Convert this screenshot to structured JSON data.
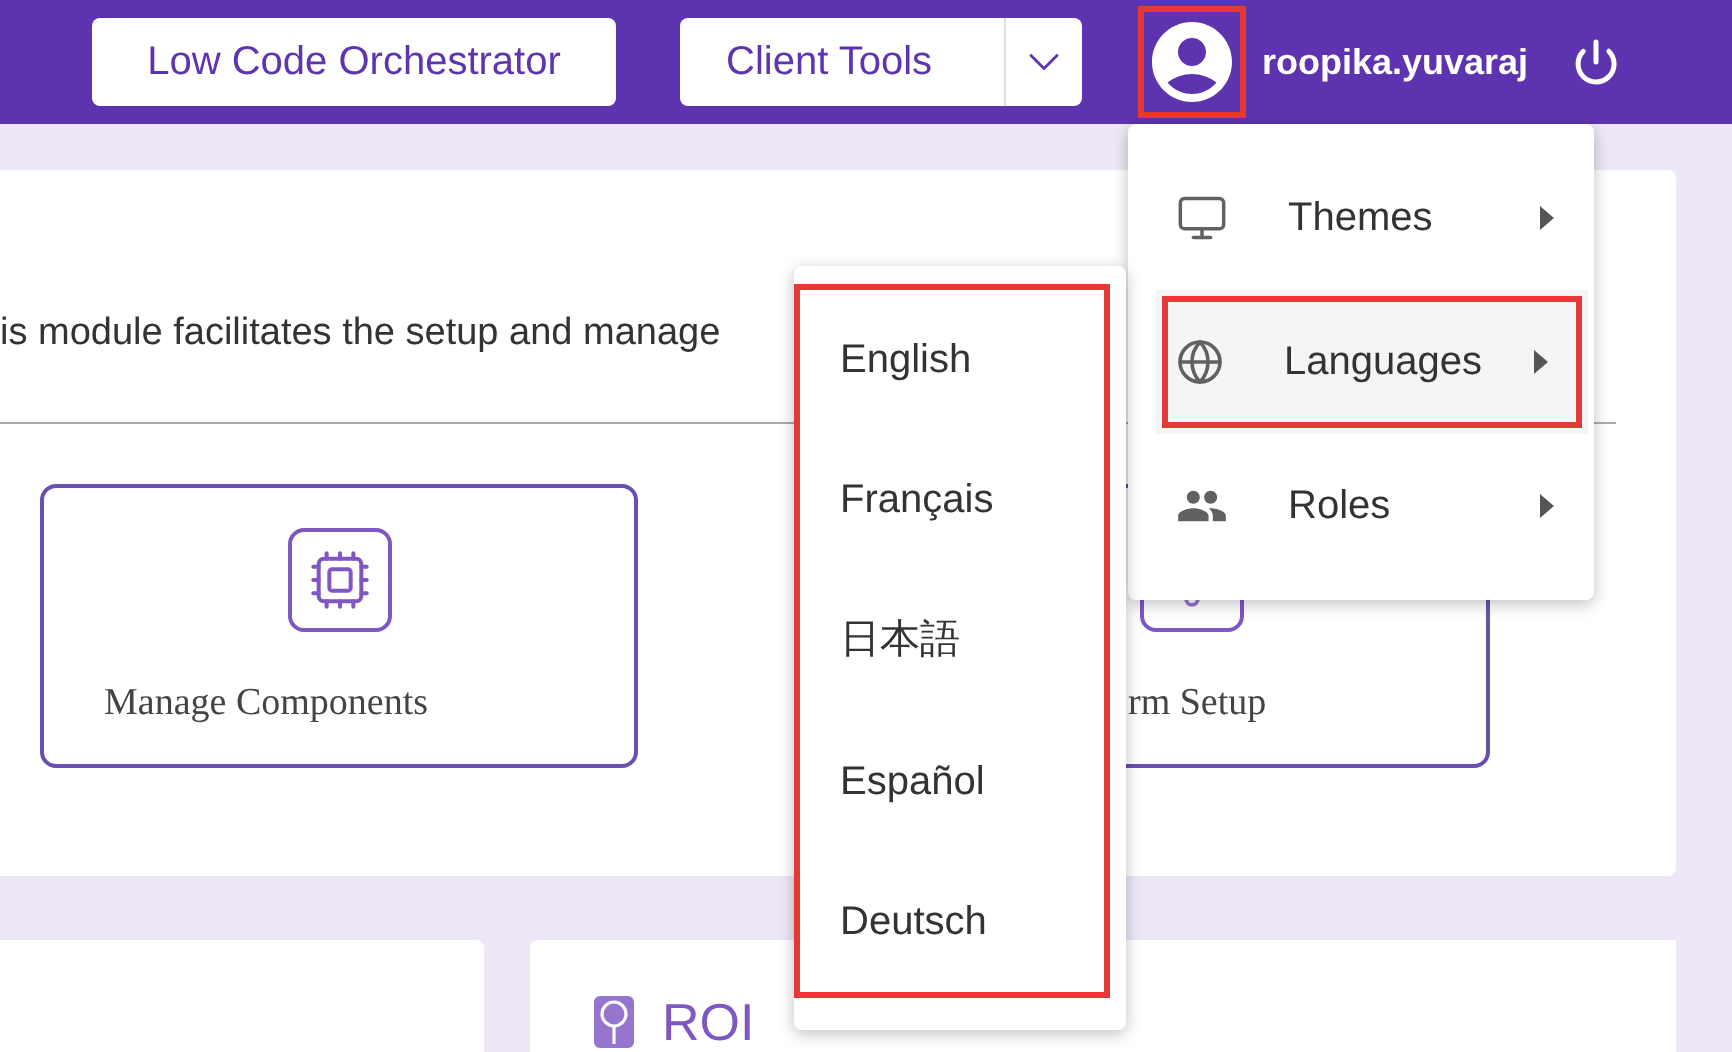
{
  "header": {
    "buttons": [
      {
        "label": "Low Code Orchestrator",
        "kind": "plain"
      },
      {
        "label": "Client Tools",
        "kind": "split"
      }
    ],
    "user": {
      "name": "roopika.yuvaraj",
      "highlighted": true
    }
  },
  "module": {
    "description": "is module facilitates the setup and manage",
    "tiles": [
      {
        "label": "Manage Components",
        "kind": "components"
      },
      {
        "label": "rm Setup",
        "kind": "setup"
      }
    ]
  },
  "bottom_panel": {
    "title": "ROI"
  },
  "profile_menu": {
    "items": [
      {
        "label": "Themes",
        "kind": "themes",
        "selected": false
      },
      {
        "label": "Languages",
        "kind": "languages",
        "selected": true
      },
      {
        "label": "Roles",
        "kind": "roles",
        "selected": false
      }
    ]
  },
  "language_menu": {
    "highlighted": true,
    "items": [
      {
        "label": "English"
      },
      {
        "label": "Français"
      },
      {
        "label": "日本語"
      },
      {
        "label": "Español"
      },
      {
        "label": "Deutsch"
      }
    ]
  }
}
